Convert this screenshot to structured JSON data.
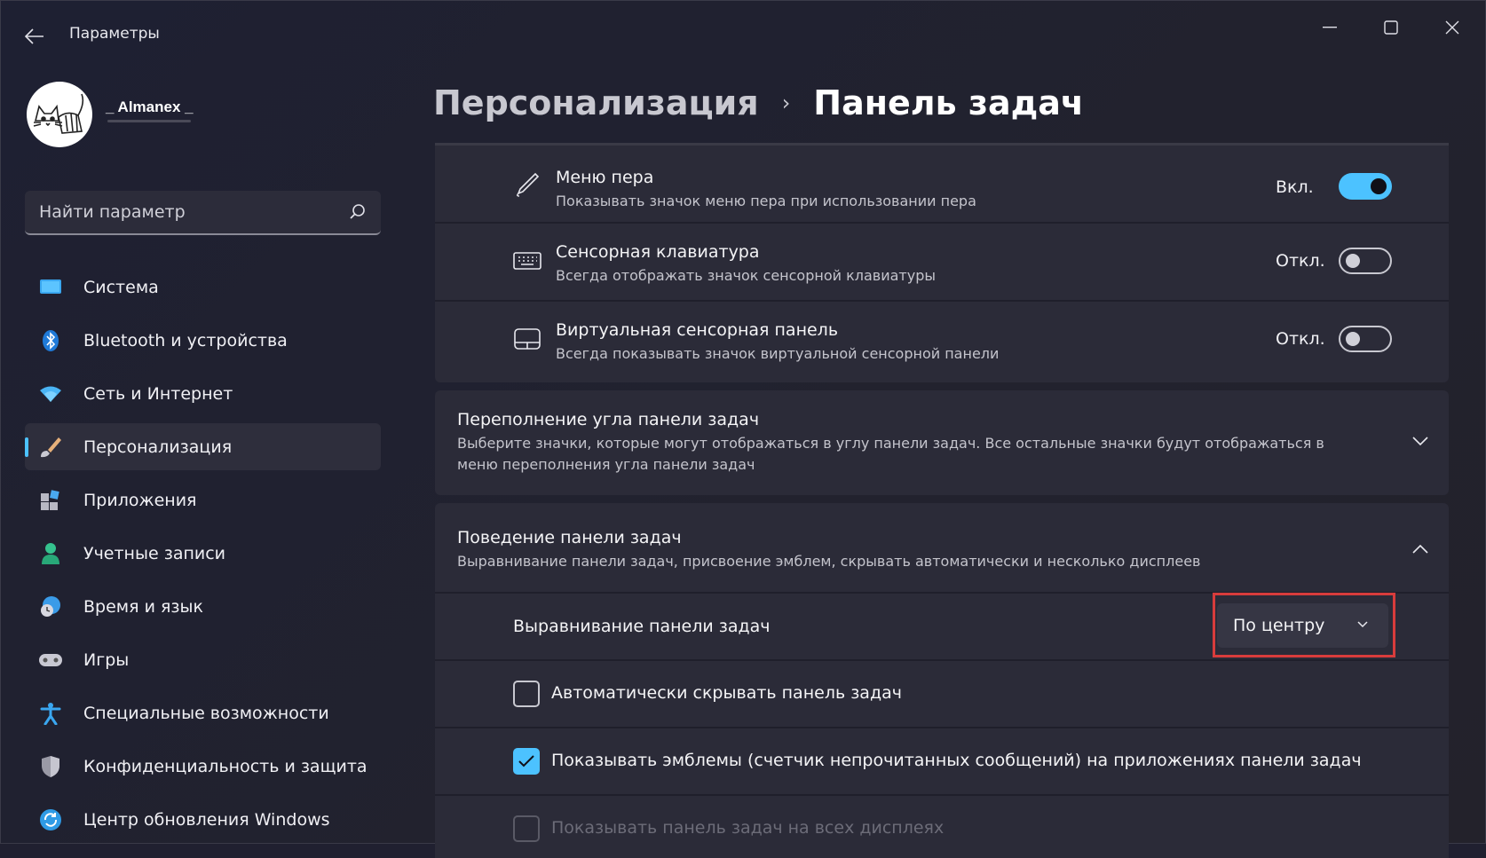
{
  "window": {
    "title": "Параметры",
    "controls": [
      "minimize",
      "maximize",
      "close"
    ]
  },
  "profile": {
    "name": "_ Almanex _"
  },
  "search": {
    "placeholder": "Найти параметр"
  },
  "sidebar": {
    "items": [
      {
        "label": "Система",
        "icon": "system-icon",
        "active": false
      },
      {
        "label": "Bluetooth и устройства",
        "icon": "bluetooth-icon",
        "active": false
      },
      {
        "label": "Сеть и Интернет",
        "icon": "wifi-icon",
        "active": false
      },
      {
        "label": "Персонализация",
        "icon": "brush-icon",
        "active": true
      },
      {
        "label": "Приложения",
        "icon": "apps-icon",
        "active": false
      },
      {
        "label": "Учетные записи",
        "icon": "account-icon",
        "active": false
      },
      {
        "label": "Время и язык",
        "icon": "time-language-icon",
        "active": false
      },
      {
        "label": "Игры",
        "icon": "gamepad-icon",
        "active": false
      },
      {
        "label": "Специальные возможности",
        "icon": "accessibility-icon",
        "active": false
      },
      {
        "label": "Конфиденциальность и защита",
        "icon": "shield-icon",
        "active": false
      },
      {
        "label": "Центр обновления Windows",
        "icon": "update-icon",
        "active": false
      }
    ]
  },
  "header": {
    "parent": "Персонализация",
    "separator": "›",
    "current": "Панель задач"
  },
  "taskbar_items": [
    {
      "title": "Меню пера",
      "desc": "Показывать значок меню пера при использовании пера",
      "state": "Вкл.",
      "on": true,
      "icon": "pen-icon"
    },
    {
      "title": "Сенсорная клавиатура",
      "desc": "Всегда отображать значок сенсорной клавиатуры",
      "state": "Откл.",
      "on": false,
      "icon": "keyboard-icon"
    },
    {
      "title": "Виртуальная сенсорная панель",
      "desc": "Всегда показывать значок виртуальной сенсорной панели",
      "state": "Откл.",
      "on": false,
      "icon": "touchpad-icon"
    }
  ],
  "overflow": {
    "title": "Переполнение угла панели задач",
    "desc": "Выберите значки, которые могут отображаться в углу панели задач. Все остальные значки будут отображаться в меню переполнения угла панели задач",
    "expanded": false
  },
  "behavior": {
    "title": "Поведение панели задач",
    "desc": "Выравнивание панели задач, присвоение эмблем, скрывать автоматически и несколько дисплеев",
    "expanded": true,
    "alignment_label": "Выравнивание панели задач",
    "alignment_value": "По центру",
    "options": [
      {
        "label": "Автоматически скрывать панель задач",
        "checked": false,
        "disabled": false
      },
      {
        "label": "Показывать эмблемы (счетчик непрочитанных сообщений) на приложениях панели задач",
        "checked": true,
        "disabled": false
      },
      {
        "label": "Показывать панель задач на всех дисплеях",
        "checked": false,
        "disabled": true
      }
    ]
  },
  "colors": {
    "accent": "#4cc2ff",
    "highlight": "#d83c3c",
    "card": "#2b2b38"
  }
}
